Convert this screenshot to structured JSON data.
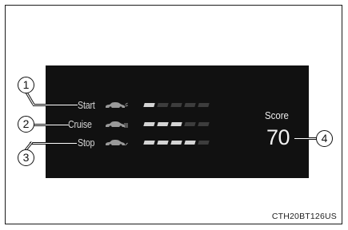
{
  "rows": [
    {
      "label": "Start",
      "callout": "1",
      "filled": 1,
      "segments": 5
    },
    {
      "label": "Cruise",
      "callout": "2",
      "filled": 3,
      "segments": 5
    },
    {
      "label": "Stop",
      "callout": "3",
      "filled": 4,
      "segments": 5
    }
  ],
  "score": {
    "label": "Score",
    "value": "70",
    "callout": "4"
  },
  "image_code": "CTH20BT126US",
  "colors": {
    "display_bg": "#111111",
    "segment_on": "#d4d4d4",
    "segment_off": "#3d3d3d",
    "text": "#d7d7d7"
  }
}
